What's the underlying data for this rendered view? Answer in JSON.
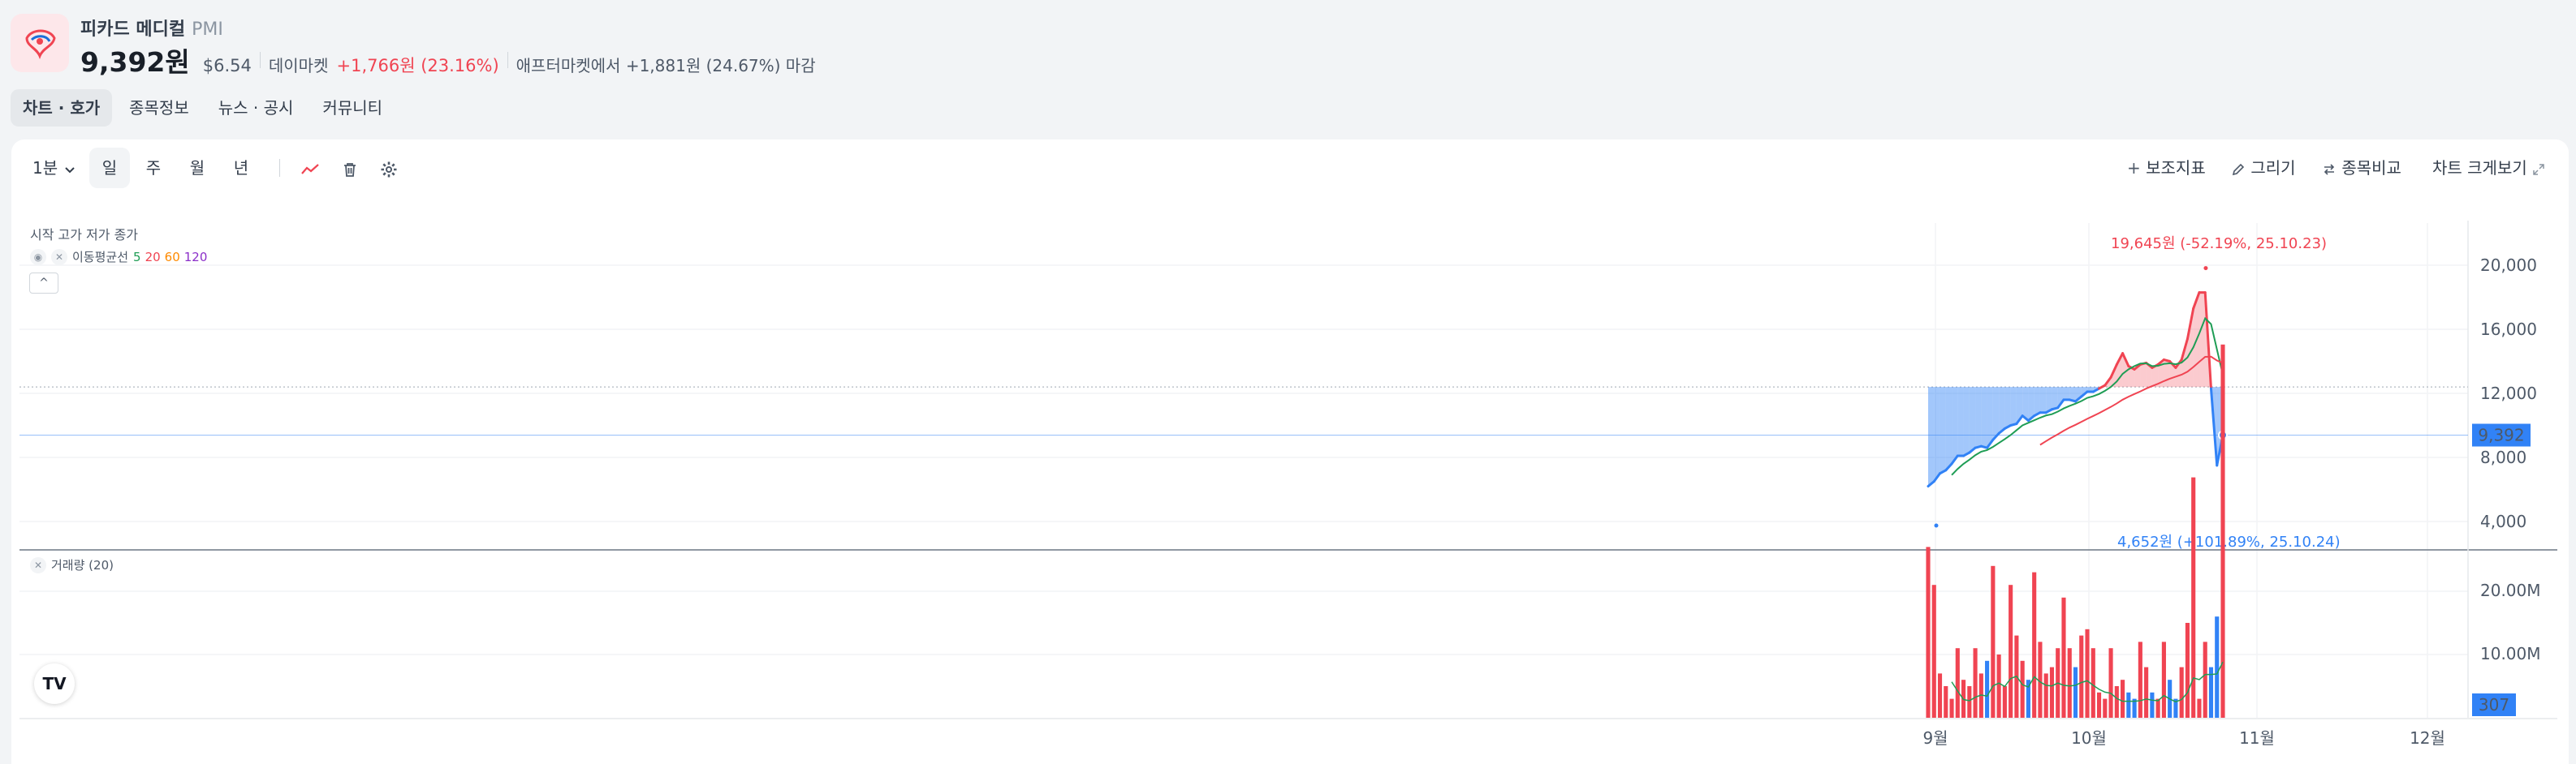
{
  "stock": {
    "name": "피카드 메디컬",
    "ticker": "PMI",
    "price": "9,392원",
    "usd": "$6.54",
    "market": "데이마켓",
    "change": "+1,766원 (23.16%)",
    "after_market": "애프터마켓에서 +1,881원 (24.67%) 마감"
  },
  "tabs": [
    "차트 · 호가",
    "종목정보",
    "뉴스 · 공시",
    "커뮤니티"
  ],
  "toolbar": {
    "interval": "1분",
    "periods": [
      "일",
      "주",
      "월",
      "년"
    ],
    "indicators": "보조지표",
    "draw": "그리기",
    "compare": "종목비교",
    "expand": "차트 크게보기"
  },
  "legend": {
    "ohlc": "시작 고가 저가 종가",
    "ma_label": "이동평균선",
    "ma_periods": [
      "5",
      "20",
      "60",
      "120"
    ],
    "ma_colors": [
      "#1f9d55",
      "#f04452",
      "#ff8a00",
      "#8b2fc9"
    ],
    "volume": "거래량 (20)"
  },
  "colors": {
    "up": "#f04452",
    "down": "#3182f6",
    "badge": "#3182f6"
  },
  "chart_data": {
    "type": "line",
    "y_axis_labels": [
      "20,000",
      "16,000",
      "12,000",
      "8,000",
      "4,000"
    ],
    "volume_axis_labels": [
      "20.00M",
      "10.00M"
    ],
    "x_axis_labels": [
      "9월",
      "10월",
      "11월",
      "12월"
    ],
    "current_price_label": "9,392",
    "current_volume_label": "307",
    "max_annotation": "19,645원 (-52.19%, 25.10.23)",
    "min_annotation": "4,652원 (+101.89%, 25.10.24)",
    "baseline": 12400,
    "series": [
      {
        "values": [
          6200,
          6500,
          7000,
          7200,
          7600,
          8100,
          8100,
          8300,
          8600,
          8700,
          8600,
          9100,
          9500,
          9800,
          10000,
          10100,
          10600,
          10300,
          10600,
          10800,
          10800,
          11000,
          11100,
          11600,
          11600,
          11500,
          11800,
          12100,
          12100,
          12300,
          12500,
          13000,
          13800,
          14500,
          13700,
          13500,
          13800,
          13900,
          13600,
          13800,
          14100,
          14000,
          13600,
          14100,
          15400,
          17300,
          18300,
          18300,
          12300,
          7500,
          9392
        ]
      }
    ],
    "volume_series": [
      {
        "values": [
          2.7,
          2.1,
          0.7,
          0.5,
          0.3,
          1.1,
          0.6,
          0.5,
          1.1,
          0.7,
          0.9,
          2.4,
          1.0,
          0.5,
          2.1,
          1.3,
          0.9,
          0.6,
          2.3,
          1.2,
          0.7,
          0.8,
          1.1,
          1.9,
          1.1,
          0.8,
          1.3,
          1.4,
          1.1,
          0.4,
          0.3,
          1.1,
          0.5,
          0.6,
          0.4,
          0.3,
          1.2,
          0.8,
          0.4,
          0.3,
          1.2,
          0.6,
          0.3,
          0.8,
          1.5,
          3.8,
          0.3,
          1.2,
          0.8,
          1.6,
          5.9
        ]
      }
    ]
  }
}
